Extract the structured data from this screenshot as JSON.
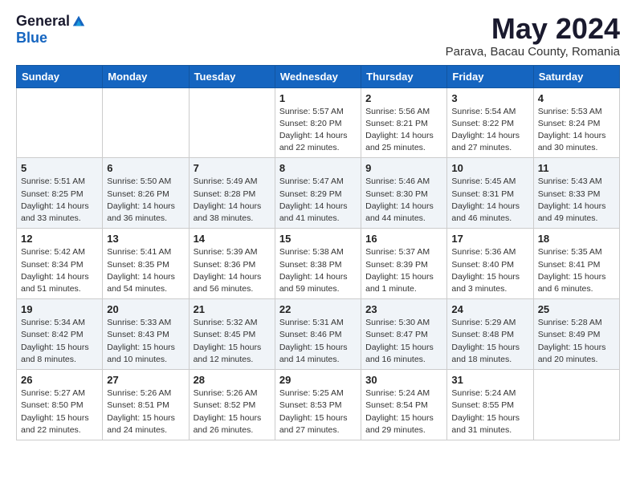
{
  "header": {
    "logo_general": "General",
    "logo_blue": "Blue",
    "month_title": "May 2024",
    "location": "Parava, Bacau County, Romania"
  },
  "days_of_week": [
    "Sunday",
    "Monday",
    "Tuesday",
    "Wednesday",
    "Thursday",
    "Friday",
    "Saturday"
  ],
  "weeks": [
    [
      {
        "day": "",
        "detail": ""
      },
      {
        "day": "",
        "detail": ""
      },
      {
        "day": "",
        "detail": ""
      },
      {
        "day": "1",
        "detail": "Sunrise: 5:57 AM\nSunset: 8:20 PM\nDaylight: 14 hours\nand 22 minutes."
      },
      {
        "day": "2",
        "detail": "Sunrise: 5:56 AM\nSunset: 8:21 PM\nDaylight: 14 hours\nand 25 minutes."
      },
      {
        "day": "3",
        "detail": "Sunrise: 5:54 AM\nSunset: 8:22 PM\nDaylight: 14 hours\nand 27 minutes."
      },
      {
        "day": "4",
        "detail": "Sunrise: 5:53 AM\nSunset: 8:24 PM\nDaylight: 14 hours\nand 30 minutes."
      }
    ],
    [
      {
        "day": "5",
        "detail": "Sunrise: 5:51 AM\nSunset: 8:25 PM\nDaylight: 14 hours\nand 33 minutes."
      },
      {
        "day": "6",
        "detail": "Sunrise: 5:50 AM\nSunset: 8:26 PM\nDaylight: 14 hours\nand 36 minutes."
      },
      {
        "day": "7",
        "detail": "Sunrise: 5:49 AM\nSunset: 8:28 PM\nDaylight: 14 hours\nand 38 minutes."
      },
      {
        "day": "8",
        "detail": "Sunrise: 5:47 AM\nSunset: 8:29 PM\nDaylight: 14 hours\nand 41 minutes."
      },
      {
        "day": "9",
        "detail": "Sunrise: 5:46 AM\nSunset: 8:30 PM\nDaylight: 14 hours\nand 44 minutes."
      },
      {
        "day": "10",
        "detail": "Sunrise: 5:45 AM\nSunset: 8:31 PM\nDaylight: 14 hours\nand 46 minutes."
      },
      {
        "day": "11",
        "detail": "Sunrise: 5:43 AM\nSunset: 8:33 PM\nDaylight: 14 hours\nand 49 minutes."
      }
    ],
    [
      {
        "day": "12",
        "detail": "Sunrise: 5:42 AM\nSunset: 8:34 PM\nDaylight: 14 hours\nand 51 minutes."
      },
      {
        "day": "13",
        "detail": "Sunrise: 5:41 AM\nSunset: 8:35 PM\nDaylight: 14 hours\nand 54 minutes."
      },
      {
        "day": "14",
        "detail": "Sunrise: 5:39 AM\nSunset: 8:36 PM\nDaylight: 14 hours\nand 56 minutes."
      },
      {
        "day": "15",
        "detail": "Sunrise: 5:38 AM\nSunset: 8:38 PM\nDaylight: 14 hours\nand 59 minutes."
      },
      {
        "day": "16",
        "detail": "Sunrise: 5:37 AM\nSunset: 8:39 PM\nDaylight: 15 hours\nand 1 minute."
      },
      {
        "day": "17",
        "detail": "Sunrise: 5:36 AM\nSunset: 8:40 PM\nDaylight: 15 hours\nand 3 minutes."
      },
      {
        "day": "18",
        "detail": "Sunrise: 5:35 AM\nSunset: 8:41 PM\nDaylight: 15 hours\nand 6 minutes."
      }
    ],
    [
      {
        "day": "19",
        "detail": "Sunrise: 5:34 AM\nSunset: 8:42 PM\nDaylight: 15 hours\nand 8 minutes."
      },
      {
        "day": "20",
        "detail": "Sunrise: 5:33 AM\nSunset: 8:43 PM\nDaylight: 15 hours\nand 10 minutes."
      },
      {
        "day": "21",
        "detail": "Sunrise: 5:32 AM\nSunset: 8:45 PM\nDaylight: 15 hours\nand 12 minutes."
      },
      {
        "day": "22",
        "detail": "Sunrise: 5:31 AM\nSunset: 8:46 PM\nDaylight: 15 hours\nand 14 minutes."
      },
      {
        "day": "23",
        "detail": "Sunrise: 5:30 AM\nSunset: 8:47 PM\nDaylight: 15 hours\nand 16 minutes."
      },
      {
        "day": "24",
        "detail": "Sunrise: 5:29 AM\nSunset: 8:48 PM\nDaylight: 15 hours\nand 18 minutes."
      },
      {
        "day": "25",
        "detail": "Sunrise: 5:28 AM\nSunset: 8:49 PM\nDaylight: 15 hours\nand 20 minutes."
      }
    ],
    [
      {
        "day": "26",
        "detail": "Sunrise: 5:27 AM\nSunset: 8:50 PM\nDaylight: 15 hours\nand 22 minutes."
      },
      {
        "day": "27",
        "detail": "Sunrise: 5:26 AM\nSunset: 8:51 PM\nDaylight: 15 hours\nand 24 minutes."
      },
      {
        "day": "28",
        "detail": "Sunrise: 5:26 AM\nSunset: 8:52 PM\nDaylight: 15 hours\nand 26 minutes."
      },
      {
        "day": "29",
        "detail": "Sunrise: 5:25 AM\nSunset: 8:53 PM\nDaylight: 15 hours\nand 27 minutes."
      },
      {
        "day": "30",
        "detail": "Sunrise: 5:24 AM\nSunset: 8:54 PM\nDaylight: 15 hours\nand 29 minutes."
      },
      {
        "day": "31",
        "detail": "Sunrise: 5:24 AM\nSunset: 8:55 PM\nDaylight: 15 hours\nand 31 minutes."
      },
      {
        "day": "",
        "detail": ""
      }
    ]
  ]
}
